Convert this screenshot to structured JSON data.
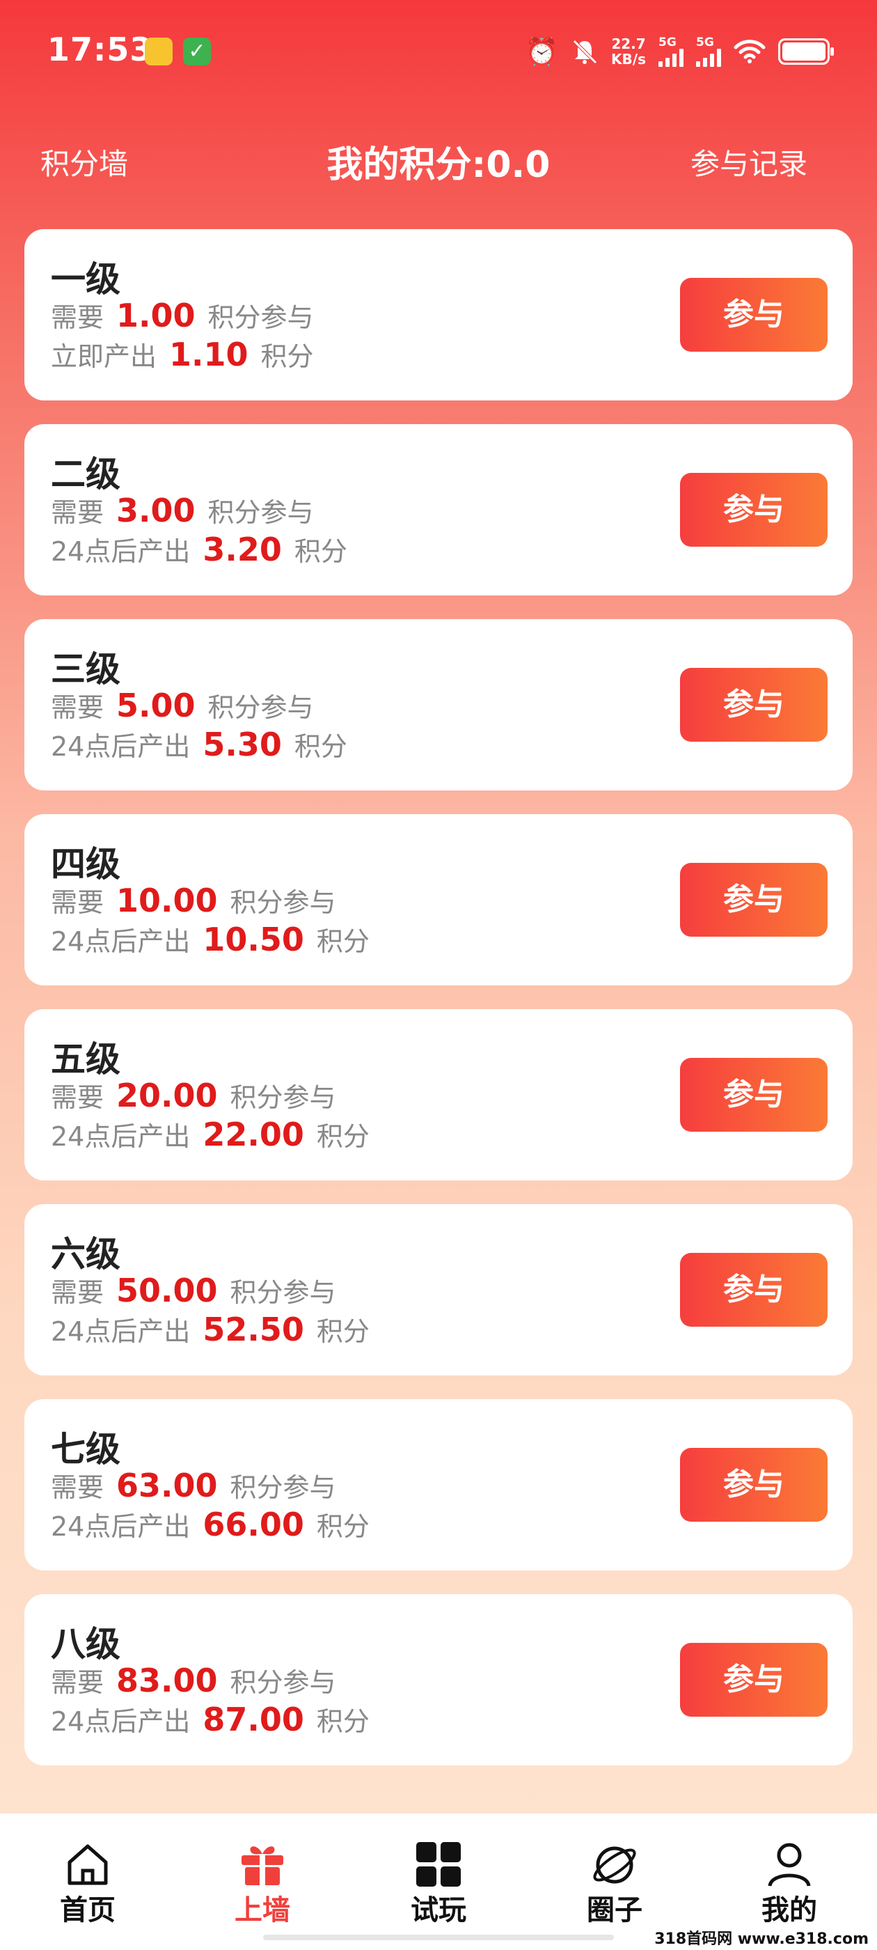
{
  "status_bar": {
    "time": "17:53",
    "speed_value": "22.7",
    "speed_unit": "KB/s",
    "net1": "5G",
    "net2": "5G",
    "icons": [
      "note-icon",
      "check-icon",
      "alarm-icon",
      "mute-bell-icon",
      "signal-icon",
      "signal-icon",
      "wifi-icon",
      "battery-icon"
    ]
  },
  "header": {
    "left": "积分墙",
    "title": "我的积分:0.0",
    "right": "参与记录"
  },
  "accent_color": "#e01b1b",
  "levels": [
    {
      "name": "一级",
      "need_prefix": "需要",
      "need": "1.00",
      "need_suffix": "积分参与",
      "out_prefix": "立即产出",
      "out": "1.10",
      "out_suffix": "积分",
      "button": "参与"
    },
    {
      "name": "二级",
      "need_prefix": "需要",
      "need": "3.00",
      "need_suffix": "积分参与",
      "out_prefix": "24点后产出",
      "out": "3.20",
      "out_suffix": "积分",
      "button": "参与"
    },
    {
      "name": "三级",
      "need_prefix": "需要",
      "need": "5.00",
      "need_suffix": "积分参与",
      "out_prefix": "24点后产出",
      "out": "5.30",
      "out_suffix": "积分",
      "button": "参与"
    },
    {
      "name": "四级",
      "need_prefix": "需要",
      "need": "10.00",
      "need_suffix": "积分参与",
      "out_prefix": "24点后产出",
      "out": "10.50",
      "out_suffix": "积分",
      "button": "参与"
    },
    {
      "name": "五级",
      "need_prefix": "需要",
      "need": "20.00",
      "need_suffix": "积分参与",
      "out_prefix": "24点后产出",
      "out": "22.00",
      "out_suffix": "积分",
      "button": "参与"
    },
    {
      "name": "六级",
      "need_prefix": "需要",
      "need": "50.00",
      "need_suffix": "积分参与",
      "out_prefix": "24点后产出",
      "out": "52.50",
      "out_suffix": "积分",
      "button": "参与"
    },
    {
      "name": "七级",
      "need_prefix": "需要",
      "need": "63.00",
      "need_suffix": "积分参与",
      "out_prefix": "24点后产出",
      "out": "66.00",
      "out_suffix": "积分",
      "button": "参与"
    },
    {
      "name": "八级",
      "need_prefix": "需要",
      "need": "83.00",
      "need_suffix": "积分参与",
      "out_prefix": "24点后产出",
      "out": "87.00",
      "out_suffix": "积分",
      "button": "参与"
    }
  ],
  "nav": [
    {
      "label": "首页",
      "icon": "home-icon",
      "active": false
    },
    {
      "label": "上墙",
      "icon": "gift-icon",
      "active": true
    },
    {
      "label": "试玩",
      "icon": "grid-icon",
      "active": false
    },
    {
      "label": "圈子",
      "icon": "planet-icon",
      "active": false
    },
    {
      "label": "我的",
      "icon": "user-icon",
      "active": false
    }
  ],
  "watermark": "318首码网 www.e318.com"
}
